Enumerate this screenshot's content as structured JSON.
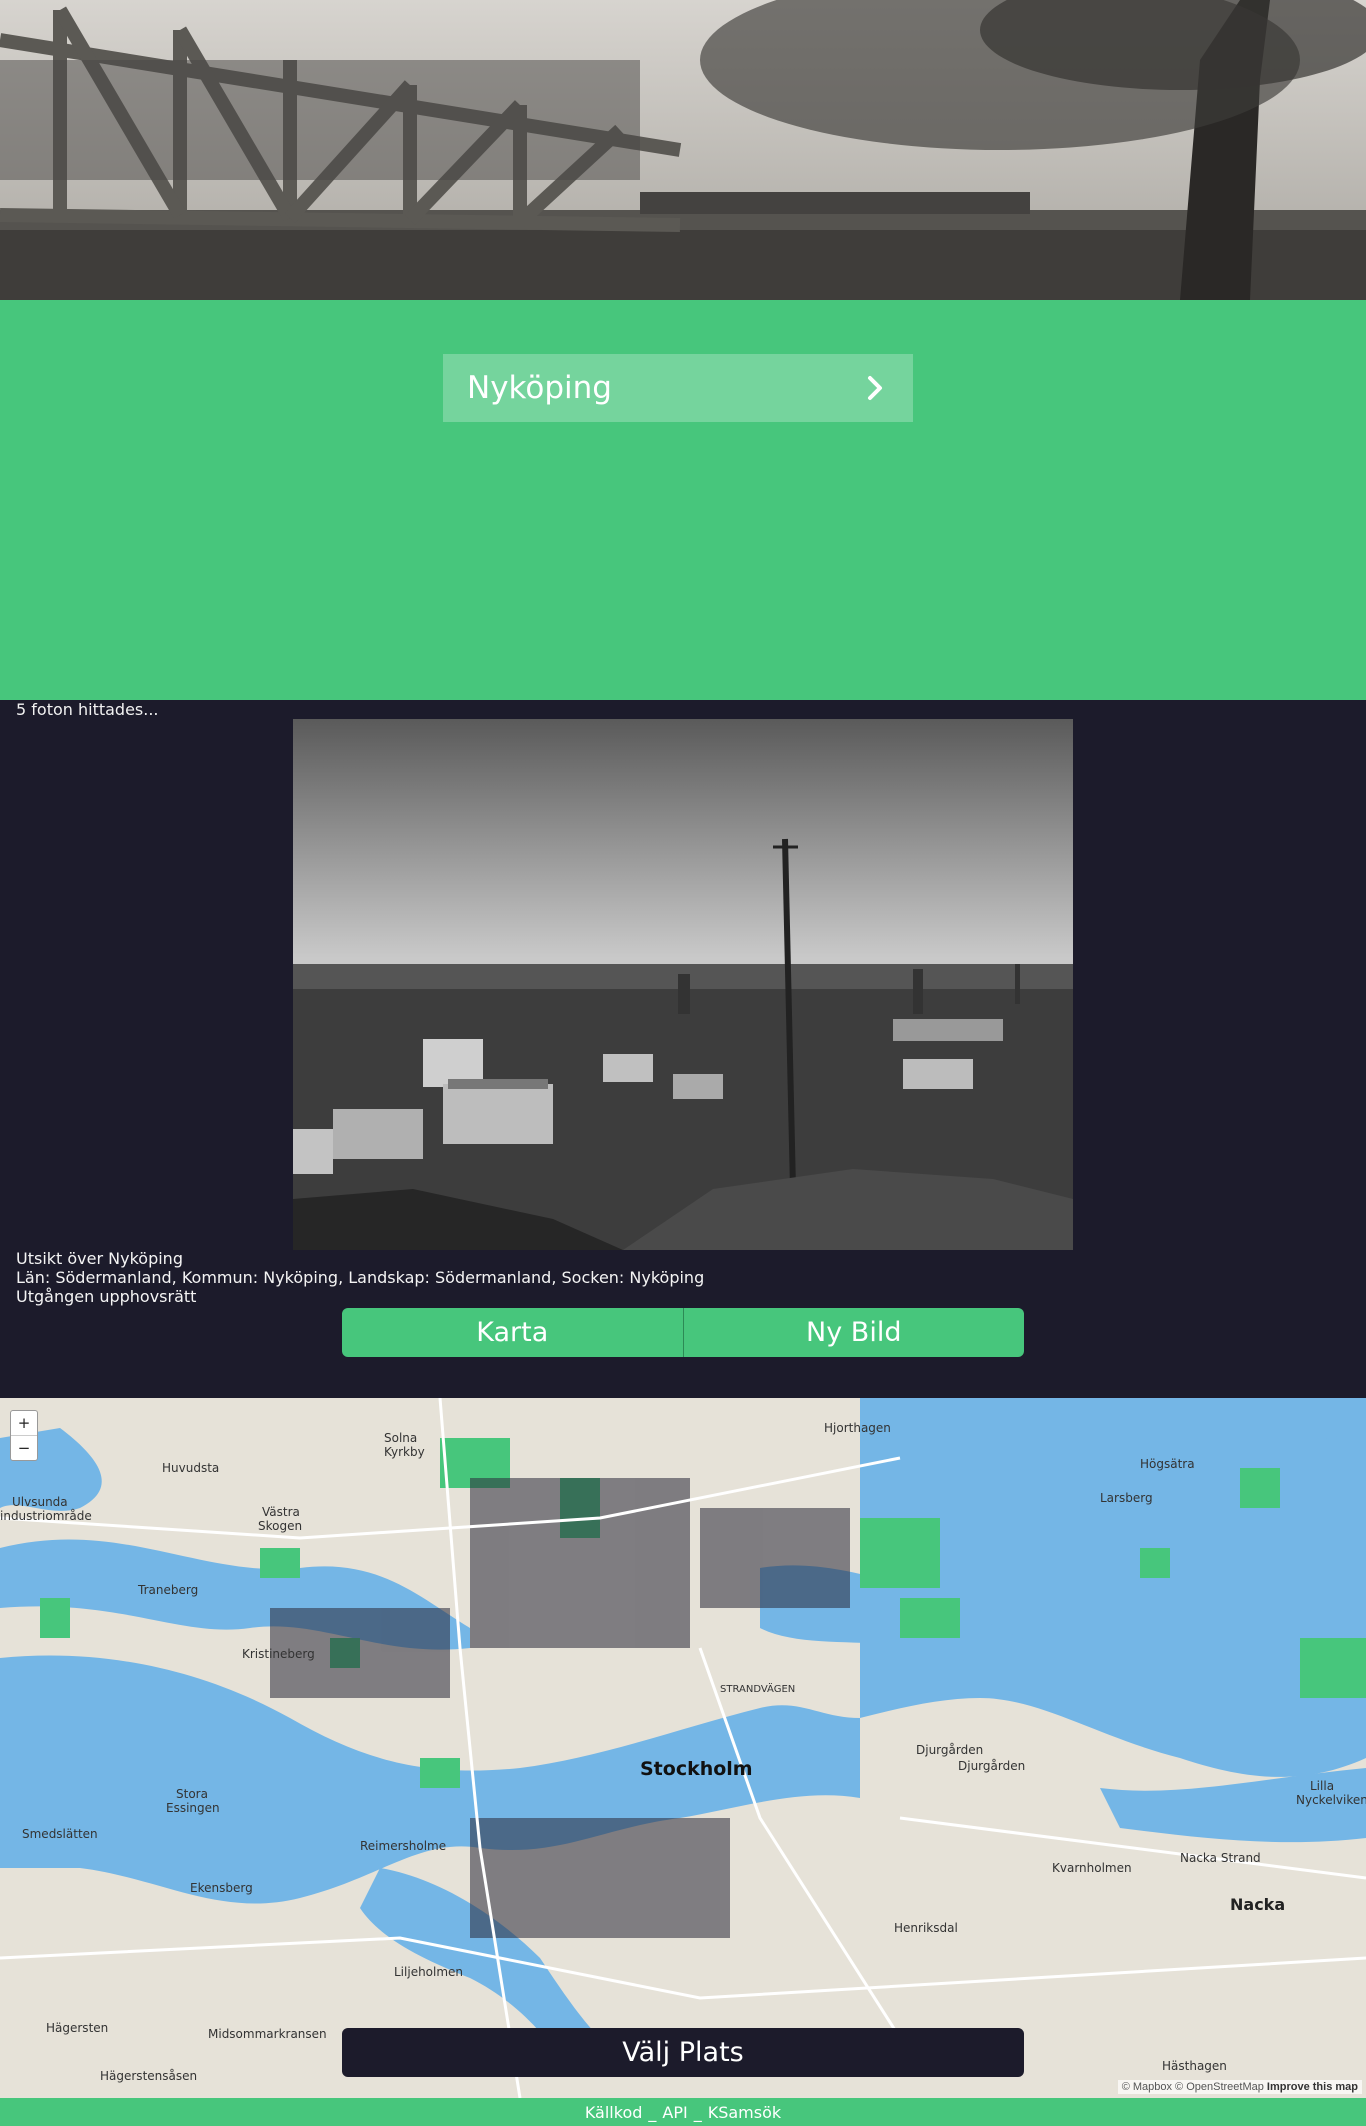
{
  "place_select": {
    "value": "Nyköping"
  },
  "results": {
    "count_text": "5 foton hittades...",
    "photo_title": "Utsikt över Nyköping",
    "photo_location": "Län: Södermanland, Kommun: Nyköping, Landskap: Södermanland, Socken: Nyköping",
    "photo_license": "Utgången upphovsrätt"
  },
  "buttons": {
    "map": "Karta",
    "new_image": "Ny Bild",
    "choose_place": "Välj Plats"
  },
  "map": {
    "zoom_in": "+",
    "zoom_out": "−",
    "attribution_a": "© Mapbox © OpenStreetMap",
    "attribution_b": "Improve this map",
    "labels": {
      "stockholm": "Stockholm",
      "solna": "Solna",
      "kyrkby": "Kyrkby",
      "huvudsta": "Huvudsta",
      "ulvsunda": "Ulvsunda",
      "industriomrade": "industriområde",
      "vastra": "Västra",
      "skogen": "Skogen",
      "traneberg": "Traneberg",
      "kristineberg": "Kristineberg",
      "stora": "Stora",
      "essingen": "Essingen",
      "smedslatten": "Smedslätten",
      "ekensberg": "Ekensberg",
      "reimersholme": "Reimersholme",
      "liljeholmen": "Liljeholmen",
      "hagersten": "Hägersten",
      "midsommarkransen": "Midsommarkransen",
      "hagerstensasen": "Hägerstensåsen",
      "djurgarden": "Djurgården",
      "djurgarden2": "Djurgården",
      "hjorthagen": "Hjorthagen",
      "larsberg": "Larsberg",
      "kvarnholmen": "Kvarnholmen",
      "nacka": "Nacka",
      "henriksdal": "Henriksdal",
      "hasthagen": "Hästhagen",
      "lilla": "Lilla",
      "nyckelviken": "Nyckelviken",
      "strandvagen": "STRANDVÄGEN",
      "hogsatra": "Högsätra",
      "stora_nacka": "Nacka Strand"
    }
  },
  "footer": {
    "source": "Källkod",
    "api": "API",
    "ksamsok": "KSamsök",
    "sep": "_"
  },
  "colors": {
    "green": "#47c67c",
    "dark": "#1c1b2b",
    "water": "#74b6e6",
    "land": "#e6e2d8",
    "park": "#47c67c"
  }
}
